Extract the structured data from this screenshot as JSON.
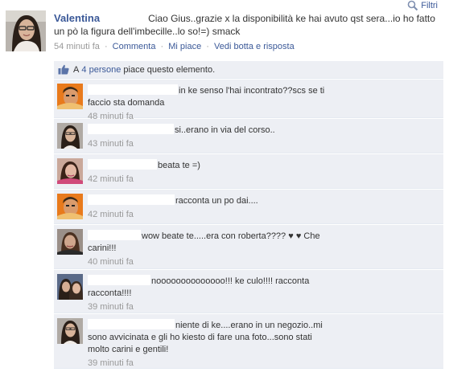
{
  "filter": {
    "label": "Filtri"
  },
  "post": {
    "author": "Valentina",
    "message": "Ciao Gius..grazie x la disponibilità ke hai avuto qst sera...io ho fatto un pò la figura dell'imbecille..lo so!=) smack",
    "time": "54 minuti fa",
    "actions": [
      "Commenta",
      "Mi piace",
      "Vedi botta e risposta"
    ]
  },
  "likes": {
    "prefix": "A",
    "link": "4 persone",
    "suffix": "piace questo elemento."
  },
  "comments": [
    {
      "text": "in ke senso l'hai incontrato??scs se ti faccio sta domanda",
      "time": "48 minuti fa",
      "avatar": "male-orange"
    },
    {
      "text": "si..erano in via del corso..",
      "time": "43 minuti fa",
      "avatar": "female-dark"
    },
    {
      "text": "beata te =)",
      "time": "42 minuti fa",
      "avatar": "female-pink"
    },
    {
      "text": "racconta un po dai....",
      "time": "42 minuti fa",
      "avatar": "male-orange"
    },
    {
      "text": "wow beate te.....era con roberta???? ♥ ♥ Che carini!!!",
      "time": "40 minuti fa",
      "avatar": "female-brown"
    },
    {
      "text": "noooooooooooooo!!! ke culo!!!! racconta racconta!!!!",
      "time": "39 minuti fa",
      "avatar": "couple"
    },
    {
      "text": "niente di ke....erano in un negozio..mi sono avvicinata e gli ho kiesto di fare una foto...sono stati molto carini e gentili!",
      "time": "39 minuti fa",
      "avatar": "female-dark"
    }
  ],
  "colors": {
    "link": "#3b5998",
    "panel": "#edeff4",
    "meta": "#999999"
  }
}
